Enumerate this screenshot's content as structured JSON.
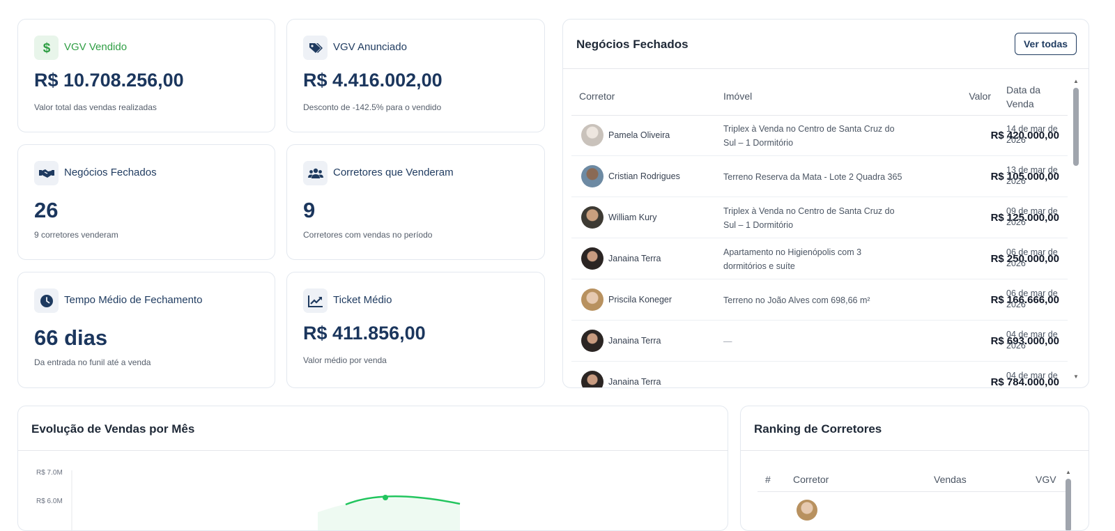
{
  "kpis": {
    "vgv_vendido": {
      "label": "VGV Vendido",
      "value": "R$ 10.708.256,00",
      "sub": "Valor total das vendas realizadas",
      "icon": "dollar-icon"
    },
    "vgv_anunciado": {
      "label": "VGV Anunciado",
      "value": "R$ 4.416.002,00",
      "sub": "Desconto de -142.5% para o vendido",
      "icon": "tag-icon"
    },
    "negocios_fechados": {
      "label": "Negócios Fechados",
      "value": "26",
      "sub": "9 corretores venderam",
      "icon": "handshake-icon"
    },
    "corretores_venderam": {
      "label": "Corretores que Venderam",
      "value": "9",
      "sub": "Corretores com vendas no período",
      "icon": "users-icon"
    },
    "tempo_medio": {
      "label": "Tempo Médio de Fechamento",
      "value": "66 dias",
      "sub": "Da entrada no funil até a venda",
      "icon": "clock-icon"
    },
    "ticket_medio": {
      "label": "Ticket Médio",
      "value": "R$ 411.856,00",
      "sub": "Valor médio por venda",
      "icon": "chart-line-icon"
    }
  },
  "deals": {
    "title": "Negócios Fechados",
    "button": "Ver todas",
    "columns": {
      "corretor": "Corretor",
      "imovel": "Imóvel",
      "valor": "Valor",
      "data": "Data da Venda"
    },
    "rows": [
      {
        "corretor": "Pamela Oliveira",
        "imovel": "Triplex à Venda no Centro de Santa Cruz do Sul – 1 Dormitório",
        "valor": "R$ 420.000,00",
        "data": "14 de mar de 2026"
      },
      {
        "corretor": "Cristian Rodrigues",
        "imovel": "Terreno Reserva da Mata - Lote 2 Quadra 365",
        "valor": "R$ 105.000,00",
        "data": "13 de mar de 2026"
      },
      {
        "corretor": "William Kury",
        "imovel": "Triplex à Venda no Centro de Santa Cruz do Sul – 1 Dormitório",
        "valor": "R$ 125.000,00",
        "data": "09 de mar de 2026"
      },
      {
        "corretor": "Janaina Terra",
        "imovel": "Apartamento no Higienópolis com 3 dormitórios e suíte",
        "valor": "R$ 250.000,00",
        "data": "06 de mar de 2026"
      },
      {
        "corretor": "Priscila Koneger",
        "imovel": "Terreno no João Alves com 698,66 m²",
        "valor": "R$ 166.666,00",
        "data": "06 de mar de 2026"
      },
      {
        "corretor": "Janaina Terra",
        "imovel": "—",
        "valor": "R$ 693.000,00",
        "data": "04 de mar de 2026"
      },
      {
        "corretor": "Janaina Terra",
        "imovel": "",
        "valor": "R$ 784.000,00",
        "data": "04 de mar de"
      }
    ]
  },
  "evolution": {
    "title": "Evolução de Vendas por Mês",
    "y_ticks": [
      "R$ 7.0M",
      "R$ 6.0M"
    ],
    "line_color": "#22c55e"
  },
  "ranking": {
    "title": "Ranking de Corretores",
    "columns": {
      "rank": "#",
      "corretor": "Corretor",
      "vendas": "Vendas",
      "vgv": "VGV"
    }
  },
  "colors": {
    "primary": "#1e3a5f",
    "accent_green": "#2f9e44",
    "chart_green": "#22c55e"
  }
}
